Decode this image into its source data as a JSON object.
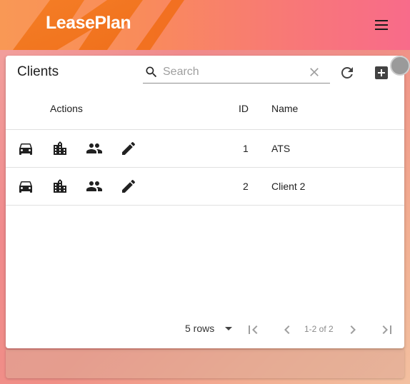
{
  "brand": {
    "logo_text": "LeasePlan"
  },
  "table": {
    "title": "Clients",
    "search": {
      "placeholder": "Search",
      "value": ""
    },
    "columns": {
      "actions": "Actions",
      "id": "ID",
      "name": "Name"
    },
    "rows": [
      {
        "id": "1",
        "name": "ATS",
        "actions": [
          "car-icon",
          "building-icon",
          "people-icon",
          "edit-icon"
        ]
      },
      {
        "id": "2",
        "name": "Client 2",
        "actions": [
          "car-icon",
          "building-icon",
          "people-icon",
          "edit-icon"
        ]
      }
    ],
    "pagination": {
      "rows_label": "5 rows",
      "range_label": "1-2 of 2"
    }
  },
  "colors": {
    "header_start": "#f99855",
    "header_end": "#f86b8a",
    "icon": "#212121",
    "disabled_icon": "#9e9e9e"
  }
}
